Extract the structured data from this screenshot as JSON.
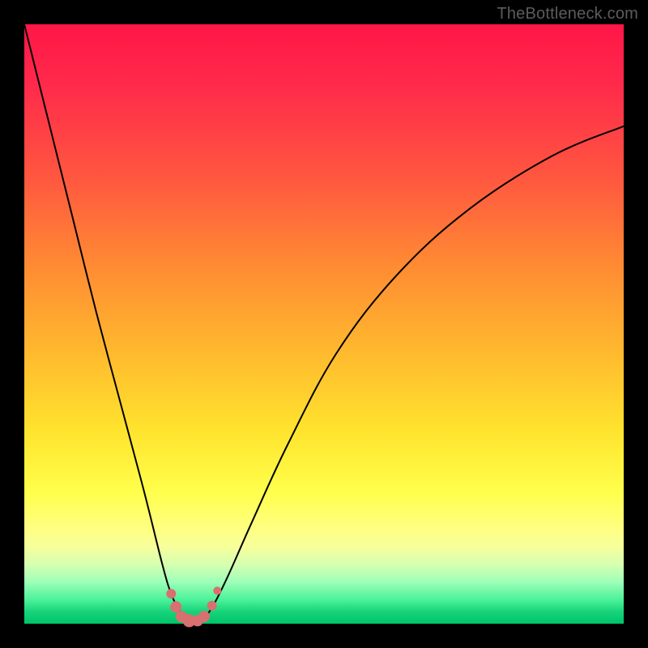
{
  "watermark": "TheBottleneck.com",
  "colors": {
    "frame_bg": "#000000",
    "curve_stroke": "#000000",
    "marker_fill": "#d87070",
    "gradient_top": "#ff1647",
    "gradient_bottom": "#00c46a"
  },
  "chart_data": {
    "type": "line",
    "title": "",
    "xlabel": "",
    "ylabel": "",
    "xlim": [
      0,
      1
    ],
    "ylim": [
      0,
      1
    ],
    "series": [
      {
        "name": "bottleneck-curve",
        "x": [
          0.0,
          0.04,
          0.08,
          0.12,
          0.16,
          0.2,
          0.23,
          0.245,
          0.26,
          0.275,
          0.29,
          0.3,
          0.315,
          0.34,
          0.38,
          0.44,
          0.52,
          0.62,
          0.74,
          0.88,
          1.0
        ],
        "y": [
          1.0,
          0.84,
          0.68,
          0.52,
          0.37,
          0.22,
          0.1,
          0.05,
          0.02,
          0.005,
          0.005,
          0.01,
          0.03,
          0.08,
          0.17,
          0.3,
          0.45,
          0.58,
          0.69,
          0.78,
          0.83
        ]
      }
    ],
    "markers": [
      {
        "x": 0.245,
        "y": 0.05,
        "r": 6
      },
      {
        "x": 0.253,
        "y": 0.028,
        "r": 7
      },
      {
        "x": 0.262,
        "y": 0.012,
        "r": 7
      },
      {
        "x": 0.275,
        "y": 0.005,
        "r": 8
      },
      {
        "x": 0.289,
        "y": 0.005,
        "r": 7
      },
      {
        "x": 0.3,
        "y": 0.012,
        "r": 7
      },
      {
        "x": 0.313,
        "y": 0.03,
        "r": 6
      },
      {
        "x": 0.322,
        "y": 0.055,
        "r": 5
      }
    ]
  }
}
